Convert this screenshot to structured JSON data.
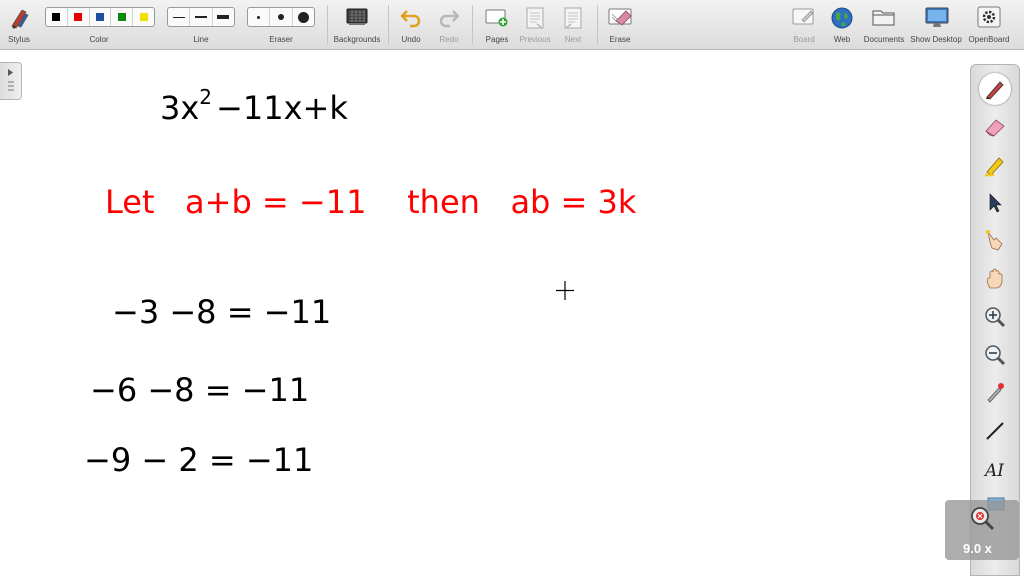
{
  "toolbar": {
    "stylus": "Stylus",
    "color": "Color",
    "line": "Line",
    "eraser": "Eraser",
    "backgrounds": "Backgrounds",
    "undo": "Undo",
    "redo": "Redo",
    "pages": "Pages",
    "previous": "Previous",
    "next": "Next",
    "erase": "Erase",
    "board": "Board",
    "web": "Web",
    "documents": "Documents",
    "show_desktop": "Show Desktop",
    "openboard": "OpenBoard",
    "colors": [
      "#000000",
      "#e00000",
      "#1f4f9f",
      "#0a8a0a",
      "#f0e000"
    ]
  },
  "canvas": {
    "expression": "3x² −11x +k",
    "expression_base": "3x",
    "expression_exp": "2",
    "expression_rest": "−11x+k",
    "hint": "Let   a+b = −11    then   ab = 3k",
    "hint_color": "#ff0000",
    "line1": "−3 −8 = −11",
    "line2": "−6 −8 = −11",
    "line3": "−9 − 2 = −11"
  },
  "zoom": {
    "level": "9.0 x"
  }
}
